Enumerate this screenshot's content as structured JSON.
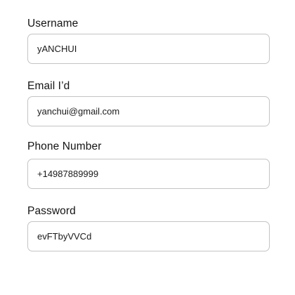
{
  "form": {
    "username": {
      "label": "Username",
      "value": "yANCHUI"
    },
    "email": {
      "label": "Email I’d",
      "value": "yanchui@gmail.com"
    },
    "phone": {
      "label": "Phone Number",
      "value": "+14987889999"
    },
    "password": {
      "label": "Password",
      "value": "evFTbyVVCd"
    }
  },
  "colors": {
    "label_text": "#141414",
    "input_border": "#c4c4c4",
    "input_text": "#1a1a1a",
    "background": "#ffffff"
  }
}
